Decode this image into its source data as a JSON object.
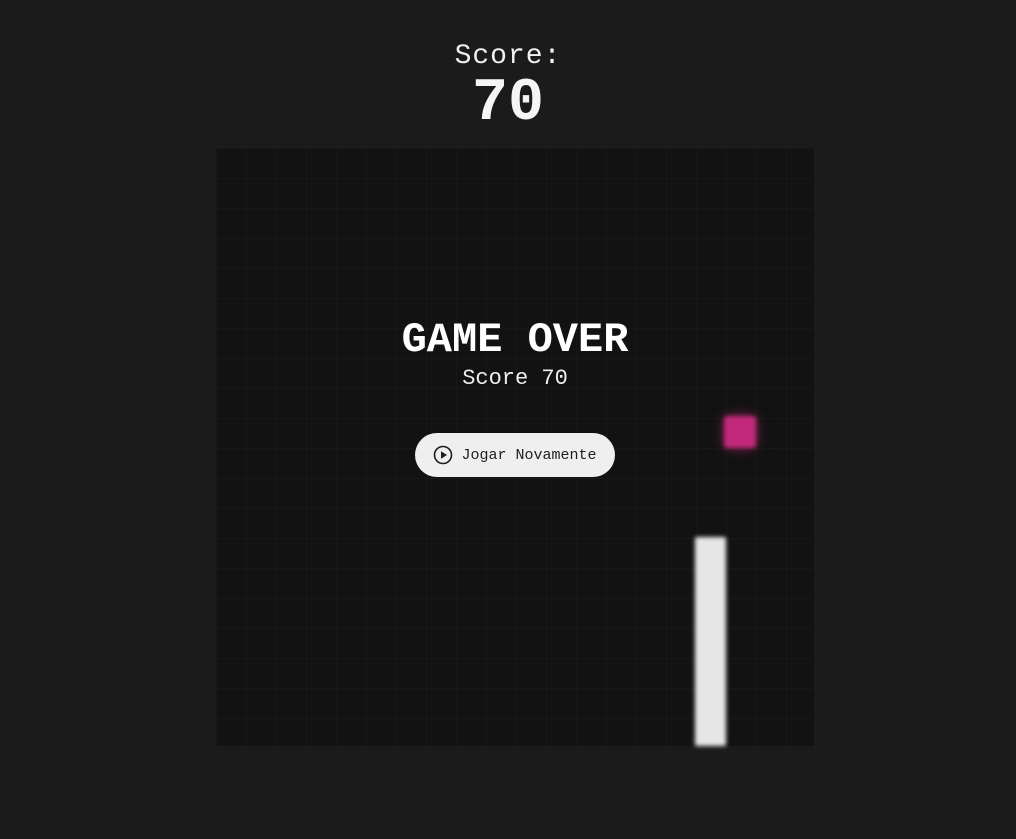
{
  "header": {
    "score_label": "Score:",
    "score_value": "70"
  },
  "board": {
    "food_color": "#c2297a",
    "snake_color": "#e6e6e6",
    "background_color": "#121212"
  },
  "game_over": {
    "title": "GAME OVER",
    "score_text": "Score 70",
    "replay_button": {
      "label": "Jogar Novamente",
      "icon": "play-circle-icon"
    }
  }
}
